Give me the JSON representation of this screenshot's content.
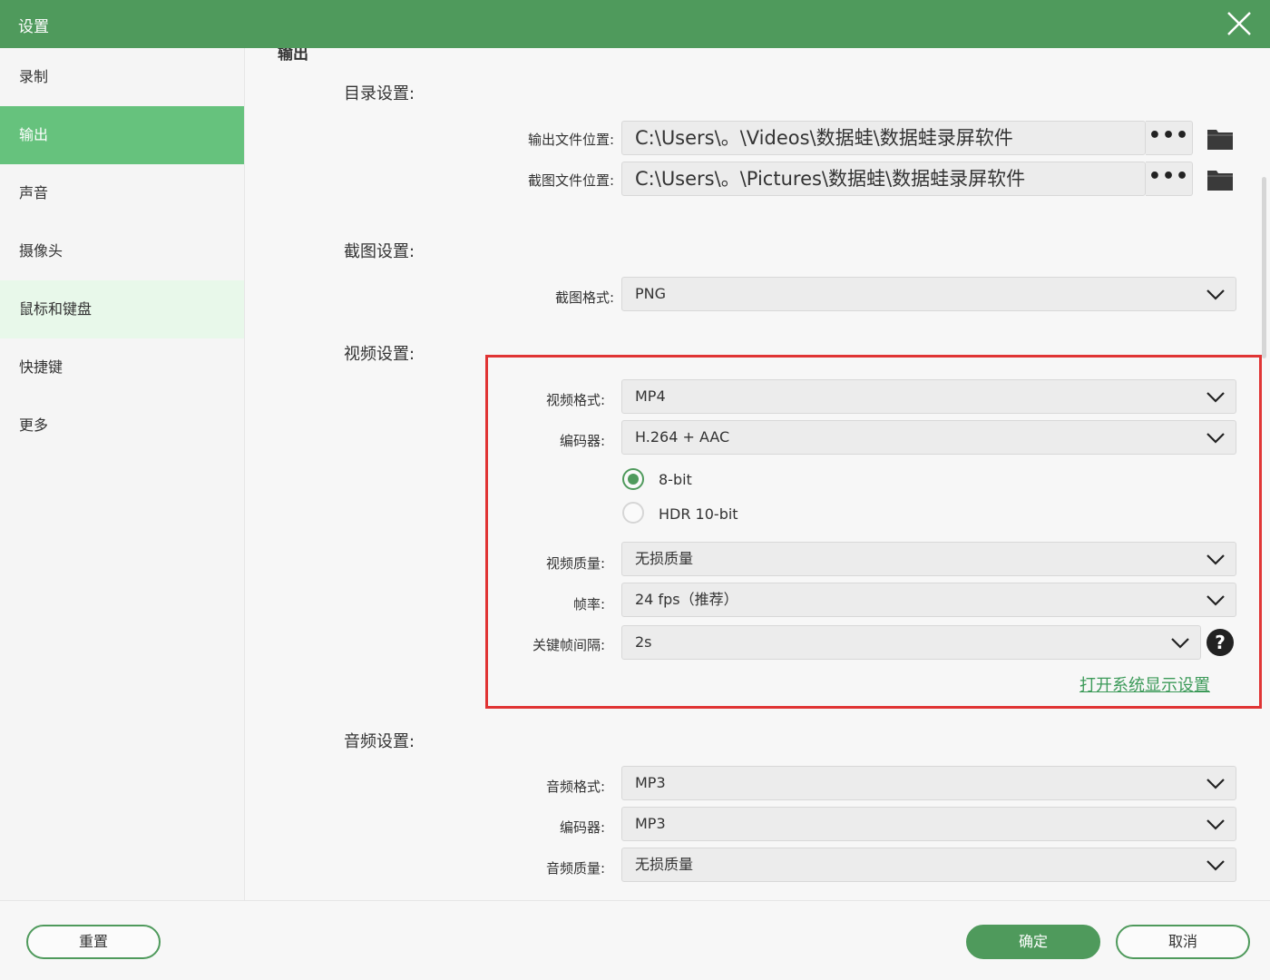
{
  "window": {
    "title": "设置"
  },
  "sidebar": {
    "items": [
      {
        "label": "录制"
      },
      {
        "label": "输出"
      },
      {
        "label": "声音"
      },
      {
        "label": "摄像头"
      },
      {
        "label": "鼠标和键盘"
      },
      {
        "label": "快捷键"
      },
      {
        "label": "更多"
      }
    ],
    "active_index": 1
  },
  "main": {
    "partial_heading": "输出",
    "directory": {
      "title": "目录设置:",
      "output_label": "输出文件位置:",
      "output_path": "C:\\Users\\。\\Videos\\数据蛙\\数据蛙录屏软件",
      "screenshot_label": "截图文件位置:",
      "screenshot_path": "C:\\Users\\。\\Pictures\\数据蛙\\数据蛙录屏软件",
      "more_button": "•••",
      "folder_icon": "folder-icon"
    },
    "screenshot": {
      "title": "截图设置:",
      "format_label": "截图格式:",
      "format_value": "PNG"
    },
    "video": {
      "title": "视频设置:",
      "format_label": "视频格式:",
      "format_value": "MP4",
      "encoder_label": "编码器:",
      "encoder_value": "H.264 + AAC",
      "bit_options": [
        {
          "label": "8-bit",
          "checked": true
        },
        {
          "label": "HDR 10-bit",
          "checked": false
        }
      ],
      "quality_label": "视频质量:",
      "quality_value": "无损质量",
      "fps_label": "帧率:",
      "fps_value": "24 fps（推荐）",
      "keyframe_label": "关键帧间隔:",
      "keyframe_value": "2s",
      "help_icon": "question-icon",
      "help_glyph": "?",
      "display_link": "打开系统显示设置"
    },
    "audio": {
      "title": "音频设置:",
      "format_label": "音频格式:",
      "format_value": "MP3",
      "encoder_label": "编码器:",
      "encoder_value": "MP3",
      "quality_label": "音频质量:",
      "quality_value": "无损质量"
    }
  },
  "footer": {
    "reset_label": "重置",
    "ok_label": "确定",
    "cancel_label": "取消"
  },
  "colors": {
    "titlebar": "#4f9a5c",
    "accent": "#66c27d",
    "hover": "#e8f8ea",
    "highlight_box": "#e03434",
    "link": "#3c9a59"
  }
}
